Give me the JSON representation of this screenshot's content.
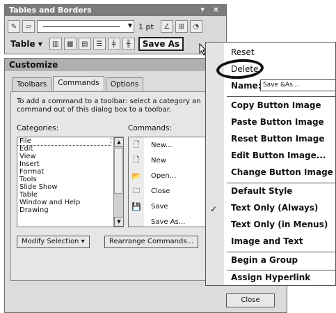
{
  "toolbar": {
    "title": "Tables and Borders",
    "title_controls": "▾ ×",
    "line_weight": "1 pt",
    "table_menu_label": "Table",
    "save_as_label": "Save As"
  },
  "dialog": {
    "title": "Customize",
    "tabs": [
      "Toolbars",
      "Commands",
      "Options"
    ],
    "instructions": "To add a command to a toolbar: select a category an command out of this dialog box to a toolbar.",
    "categories_label": "Categories:",
    "commands_label": "Commands:",
    "categories": [
      "File",
      "Edit",
      "View",
      "Insert",
      "Format",
      "Tools",
      "Slide Show",
      "Table",
      "Window and Help",
      "Drawing"
    ],
    "commands": [
      "New...",
      "New",
      "Open...",
      "Close",
      "Save",
      "Save As..."
    ],
    "modify_selection_label": "Modify Selection",
    "rearrange_label": "Rearrange Commands...",
    "close_label": "Close"
  },
  "context_menu": {
    "items": {
      "reset": "Reset",
      "delete": "Delete",
      "name_label": "Name:",
      "name_value": "Save &As...",
      "copy_image": "Copy Button Image",
      "paste_image": "Paste Button Image",
      "reset_image": "Reset Button Image",
      "edit_image": "Edit Button Image...",
      "change_image": "Change Button Image",
      "default_style": "Default Style",
      "text_only_always": "Text Only (Always)",
      "text_only_menus": "Text Only (in Menus)",
      "image_and_text": "Image and Text",
      "begin_group": "Begin a Group",
      "assign_hyperlink": "Assign Hyperlink"
    },
    "checked_item": "Text Only (Always)"
  }
}
